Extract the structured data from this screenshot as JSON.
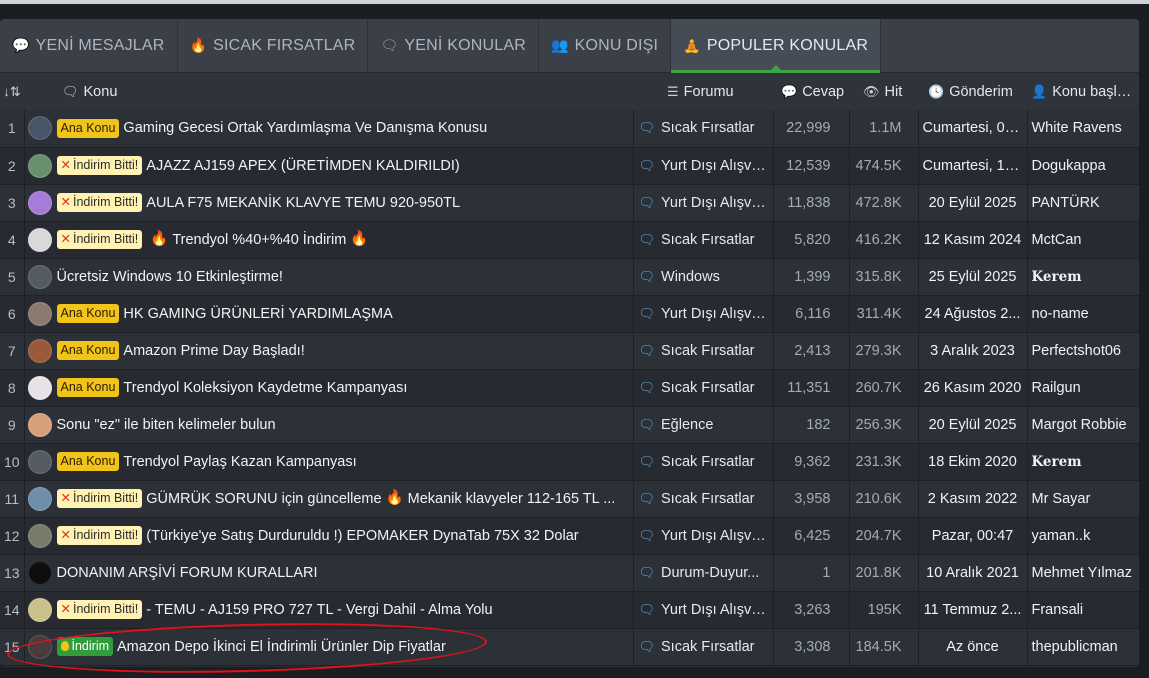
{
  "tabs": [
    {
      "label": "YENİ MESAJLAR",
      "icon": "chat-bubble-icon",
      "glyph": "💬"
    },
    {
      "label": "SICAK FIRSATLAR",
      "icon": "flame-icon",
      "glyph": "🔥"
    },
    {
      "label": "YENİ KONULAR",
      "icon": "comments-icon",
      "glyph": "🗨"
    },
    {
      "label": "KONU DIŞI",
      "icon": "users-icon",
      "glyph": "👥"
    },
    {
      "label": "POPULER KONULAR",
      "icon": "person-icon",
      "glyph": "🧘"
    }
  ],
  "active_tab": 4,
  "columns": {
    "number": "",
    "subject": "Konu",
    "forum": "Forumu",
    "replies": "Cevap",
    "hits": "Hit",
    "date": "Gönderim",
    "starter": "Konu başlatan"
  },
  "badges": {
    "ana": "Ana Konu",
    "bitti": "İndirim Bitti!",
    "indirim": "İndirim"
  },
  "colors": {
    "accent_green": "#3fa54a",
    "badge_ana": "#f2c318",
    "badge_bitti": "#fff2b3",
    "badge_indirim": "#2f9e3a",
    "forum_icon": "#5aa9e6",
    "highlight": "#e0121b"
  },
  "rows": [
    {
      "n": "1",
      "badge": "ana",
      "title": "Gaming Gecesi Ortak Yardımlaşma Ve Danışma Konusu",
      "forum": "Sıcak Fırsatlar",
      "replies": "22,999",
      "hits": "1.1M",
      "date": "Cumartesi, 00...",
      "starter": "White Ravens",
      "bold": false,
      "avatar": "#4a5468"
    },
    {
      "n": "2",
      "badge": "bitti",
      "title": "AJAZZ AJ159 APEX (ÜRETİMDEN KALDIRILDI)",
      "forum": "Yurt Dışı Alışve...",
      "replies": "12,539",
      "hits": "474.5K",
      "date": "Cumartesi, 19...",
      "starter": "Dogukappa",
      "bold": false,
      "avatar": "#6a8f6e"
    },
    {
      "n": "3",
      "badge": "bitti",
      "title": "AULA F75 MEKANİK KLAVYE TEMU 920-950TL",
      "forum": "Yurt Dışı Alışve...",
      "replies": "11,838",
      "hits": "472.8K",
      "date": "20 Eylül 2025",
      "starter": "PANTÜRK",
      "bold": false,
      "avatar": "#a77bd8"
    },
    {
      "n": "4",
      "badge": "bitti",
      "title": "Trendyol %40+%40 İndirim",
      "fire": true,
      "forum": "Sıcak Fırsatlar",
      "replies": "5,820",
      "hits": "416.2K",
      "date": "12 Kasım 2024",
      "starter": "MctCan",
      "bold": false,
      "avatar": "#d9d9d9"
    },
    {
      "n": "5",
      "badge": "",
      "title": "Ücretsiz Windows 10 Etkinleştirme!",
      "forum": "Windows",
      "replies": "1,399",
      "hits": "315.8K",
      "date": "25 Eylül 2025",
      "starter": "Kerem",
      "bold": true,
      "avatar": "#555b63"
    },
    {
      "n": "6",
      "badge": "ana",
      "title": "HK GAMING ÜRÜNLERİ YARDIMLAŞMA",
      "forum": "Yurt Dışı Alışve...",
      "replies": "6,116",
      "hits": "311.4K",
      "date": "24 Ağustos 2...",
      "starter": "no-name",
      "bold": false,
      "avatar": "#8b7a70"
    },
    {
      "n": "7",
      "badge": "ana",
      "title": "Amazon Prime Day Başladı!",
      "forum": "Sıcak Fırsatlar",
      "replies": "2,413",
      "hits": "279.3K",
      "date": "3 Aralık 2023",
      "starter": "Perfectshot06",
      "bold": false,
      "avatar": "#9a5a3a"
    },
    {
      "n": "8",
      "badge": "ana",
      "title": "Trendyol Koleksiyon Kaydetme Kampanyası",
      "forum": "Sıcak Fırsatlar",
      "replies": "11,351",
      "hits": "260.7K",
      "date": "26 Kasım 2020",
      "starter": "Railgun",
      "bold": false,
      "avatar": "#e8e2e6"
    },
    {
      "n": "9",
      "badge": "",
      "title": "Sonu \"ez\" ile biten kelimeler bulun",
      "forum": "Eğlence",
      "replies": "182",
      "hits": "256.3K",
      "date": "20 Eylül 2025",
      "starter": "Margot Robbie",
      "bold": false,
      "avatar": "#d6a07c"
    },
    {
      "n": "10",
      "badge": "ana",
      "title": "Trendyol Paylaş Kazan Kampanyası",
      "forum": "Sıcak Fırsatlar",
      "replies": "9,362",
      "hits": "231.3K",
      "date": "18 Ekim 2020",
      "starter": "Kerem",
      "bold": true,
      "avatar": "#555b63"
    },
    {
      "n": "11",
      "badge": "bitti",
      "title": "GÜMRÜK SORUNU için güncelleme",
      "title2": "Mekanik klavyeler 112-165 TL ...",
      "fire": true,
      "forum": "Sıcak Fırsatlar",
      "replies": "3,958",
      "hits": "210.6K",
      "date": "2 Kasım 2022",
      "starter": "Mr Sayar",
      "bold": false,
      "avatar": "#6f8fa8"
    },
    {
      "n": "12",
      "badge": "bitti",
      "title": "(Türkiye'ye Satış Durduruldu !) EPOMAKER DynaTab 75X 32 Dolar",
      "forum": "Yurt Dışı Alışve...",
      "replies": "6,425",
      "hits": "204.7K",
      "date": "Pazar, 00:47",
      "starter": "yaman..k",
      "bold": false,
      "avatar": "#7a7a6a"
    },
    {
      "n": "13",
      "badge": "",
      "title": "DONANIM ARŞİVİ FORUM KURALLARI",
      "forum": "Durum-Duyur...",
      "replies": "1",
      "hits": "201.8K",
      "date": "10 Aralık 2021",
      "starter": "Mehmet Yılmaz",
      "bold": false,
      "avatar": "#0e0e0e"
    },
    {
      "n": "14",
      "badge": "bitti",
      "title": "- TEMU - AJ159 PRO 727 TL - Vergi Dahil - Alma Yolu",
      "forum": "Yurt Dışı Alışve...",
      "replies": "3,263",
      "hits": "195K",
      "date": "11 Temmuz 2...",
      "starter": "Fransali",
      "bold": false,
      "avatar": "#c9c08a"
    },
    {
      "n": "15",
      "badge": "indirim",
      "title": "Amazon Depo İkinci El İndirimli Ürünler Dip Fiyatlar",
      "forum": "Sıcak Fırsatlar",
      "replies": "3,308",
      "hits": "184.5K",
      "date": "Az önce",
      "starter": "thepublicman",
      "bold": false,
      "avatar": "#4a3a3a"
    }
  ]
}
